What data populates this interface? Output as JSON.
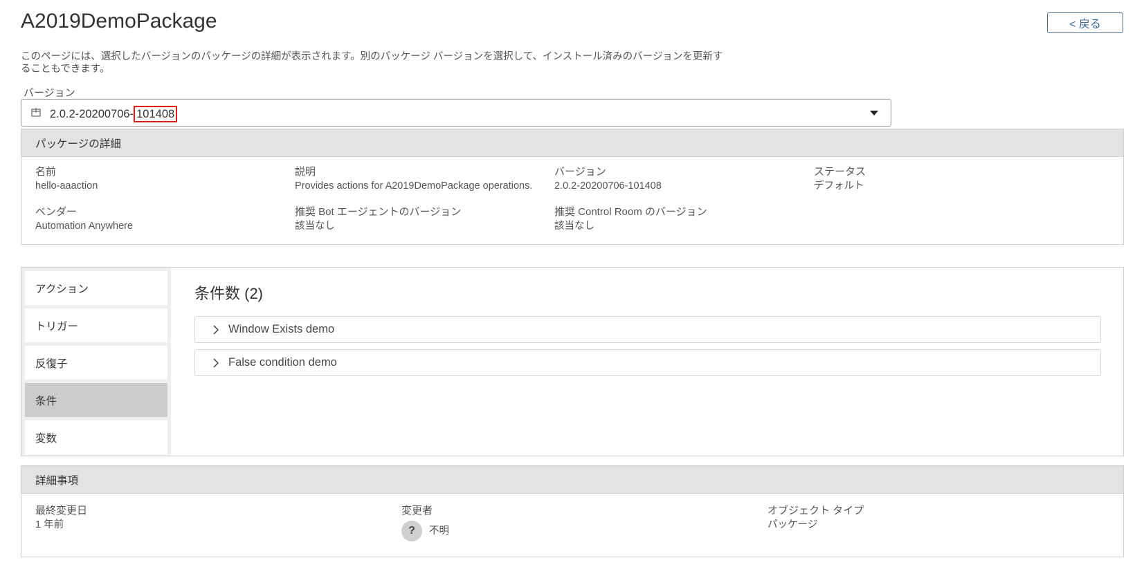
{
  "page": {
    "title": "A2019DemoPackage",
    "back_label": "< 戻る",
    "description": "このページには、選択したバージョンのパッケージの詳細が表示されます。別のパッケージ バージョンを選択して、インストール済みのバージョンを更新することもできます。"
  },
  "version_select": {
    "label": "バージョン",
    "value_prefix": "2.0.2-20200706-",
    "value_suffix": "101408",
    "icon": "package-icon"
  },
  "package_details": {
    "header": "パッケージの詳細",
    "fields": [
      {
        "label": "名前",
        "value": "hello-aaaction"
      },
      {
        "label": "説明",
        "value": "Provides actions for A2019DemoPackage operations."
      },
      {
        "label": "バージョン",
        "value": "2.0.2-20200706-101408"
      },
      {
        "label": "ステータス",
        "value": "デフォルト"
      },
      {
        "label": "ベンダー",
        "value": "Automation Anywhere"
      },
      {
        "label": "推奨 Bot エージェントのバージョン",
        "value": "該当なし"
      },
      {
        "label": "推奨 Control Room のバージョン",
        "value": "該当なし"
      }
    ]
  },
  "tabs": {
    "items": [
      {
        "label": "アクション"
      },
      {
        "label": "トリガー"
      },
      {
        "label": "反復子"
      },
      {
        "label": "条件",
        "active": true
      },
      {
        "label": "変数"
      }
    ],
    "section_title": "条件数 (2)",
    "conditions": [
      {
        "label": "Window Exists demo"
      },
      {
        "label": "False condition demo"
      }
    ]
  },
  "details": {
    "header": "詳細事項",
    "last_modified_label": "最終変更日",
    "last_modified_value": "1 年前",
    "modified_by_label": "変更者",
    "modified_by_avatar": "?",
    "modified_by_value": "不明",
    "object_type_label": "オブジェクト タイプ",
    "object_type_value": "パッケージ"
  },
  "colors": {
    "highlight": "#e21a1a",
    "header_bg": "#e3e3e3",
    "active_tab_bg": "#cccccc",
    "back_button_text": "#3d6a99"
  }
}
